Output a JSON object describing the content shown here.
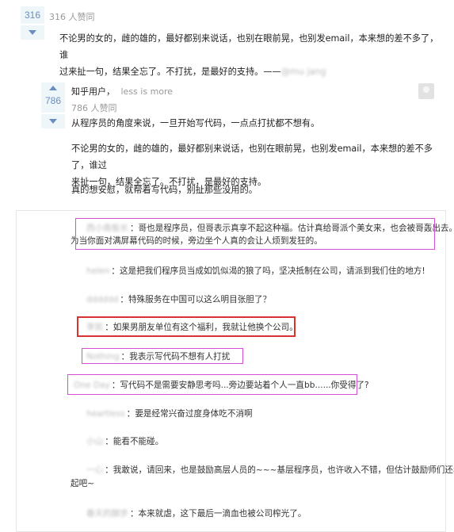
{
  "top_answer": {
    "vote_count": "316",
    "agree_text": "316 人赞同",
    "body_line1": "不论男的女的，雌的雄的，最好都别来说话，也别在眼前晃，也别发email，本来想的差不多了，谁",
    "body_line2": "过来扯一句，结果全忘了。不打扰，是最好的支持。——",
    "body_attribution": "@mu jang"
  },
  "answer": {
    "author": "知乎用户，",
    "author_bio": "less is more",
    "vote_count": "786",
    "agree_text": "786 人赞同",
    "para1": "从程序员的角度来说，一旦开始写代码，一点点打扰都不想有。",
    "para2_line1": "不论男的女的，雌的雄的，最好都别来说话，也别在眼前晃，也别发email，本来想的差不多了，谁过",
    "para2_line2": "来扯一句，结果全忘了。不打扰，是最好的支持。",
    "para3": "真的想安慰，就帮着写代码，别扯那些没用的。"
  },
  "comments": [
    {
      "name": "西小南板长",
      "text": "：哥也是程序员，但哥表示真享不起这种福。估计真给哥派个美女来，也会被哥轰出去。因",
      "text2": "为当你面对满屏幕代码的时候，旁边坐个人真的会让人烦到发狂的。"
    },
    {
      "name": "helen",
      "text": "：这是把我们程序员当成如饥似渴的狼了吗，坚决抵制在公司，请派到我们住的地方!"
    },
    {
      "name": "dddddd",
      "text": "：特殊服务在中国可以这么明目张胆了？"
    },
    {
      "name": "李凯",
      "text": "：如果男朋友单位有这个福利，我就让他换个公司。"
    },
    {
      "name": "Nothing",
      "text": "：我表示写代码不想有人打扰"
    },
    {
      "name": "One Day",
      "text": "：写代码不是需要安静思考吗...旁边要站着个人一直bb......你受得了?"
    },
    {
      "name": "heartless",
      "text": "：要是经常兴奋过度身体吃不消啊"
    },
    {
      "name": "小山",
      "text": "：能看不能碰。"
    },
    {
      "name": "一心",
      "text": "：我敢说，请回来，也是鼓励高层人员的~~~基层程序员，也许收入不错，但估计鼓励师们还看不",
      "text2": "起吧~"
    },
    {
      "name": "春天的脚步",
      "text": "：本来就虐，这下最后一滴血也被公司榨光了。"
    }
  ],
  "colors": {
    "vote_blue": "#698ebf",
    "vote_bg": "#eff6fa",
    "highlight_pink": "#d54fd5",
    "highlight_red": "#d93030"
  },
  "icons": [
    "upvote-arrow-icon",
    "downvote-arrow-icon",
    "avatar-icon"
  ]
}
